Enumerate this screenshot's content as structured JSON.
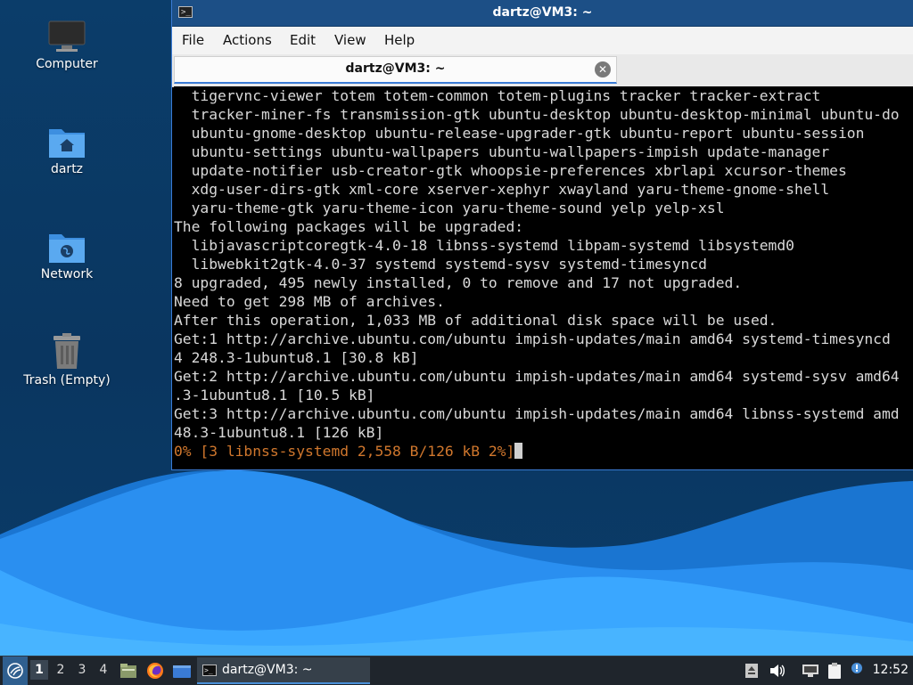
{
  "desktop": {
    "icons": [
      {
        "label": "Computer"
      },
      {
        "label": "dartz"
      },
      {
        "label": "Network"
      },
      {
        "label": "Trash (Empty)"
      }
    ]
  },
  "window": {
    "title": "dartz@VM3: ~",
    "menu": [
      "File",
      "Actions",
      "Edit",
      "View",
      "Help"
    ],
    "tab_title": "dartz@VM3: ~",
    "terminal_lines": [
      "  tigervnc-viewer totem totem-common totem-plugins tracker tracker-extract",
      "  tracker-miner-fs transmission-gtk ubuntu-desktop ubuntu-desktop-minimal ubuntu-do",
      "  ubuntu-gnome-desktop ubuntu-release-upgrader-gtk ubuntu-report ubuntu-session",
      "  ubuntu-settings ubuntu-wallpapers ubuntu-wallpapers-impish update-manager",
      "  update-notifier usb-creator-gtk whoopsie-preferences xbrlapi xcursor-themes",
      "  xdg-user-dirs-gtk xml-core xserver-xephyr xwayland yaru-theme-gnome-shell",
      "  yaru-theme-gtk yaru-theme-icon yaru-theme-sound yelp yelp-xsl",
      "The following packages will be upgraded:",
      "  libjavascriptcoregtk-4.0-18 libnss-systemd libpam-systemd libsystemd0",
      "  libwebkit2gtk-4.0-37 systemd systemd-sysv systemd-timesyncd",
      "8 upgraded, 495 newly installed, 0 to remove and 17 not upgraded.",
      "Need to get 298 MB of archives.",
      "After this operation, 1,033 MB of additional disk space will be used.",
      "Get:1 http://archive.ubuntu.com/ubuntu impish-updates/main amd64 systemd-timesyncd",
      "4 248.3-1ubuntu8.1 [30.8 kB]",
      "Get:2 http://archive.ubuntu.com/ubuntu impish-updates/main amd64 systemd-sysv amd64",
      ".3-1ubuntu8.1 [10.5 kB]",
      "Get:3 http://archive.ubuntu.com/ubuntu impish-updates/main amd64 libnss-systemd amd",
      "48.3-1ubuntu8.1 [126 kB]"
    ],
    "progress_line": "0% [3 libnss-systemd 2,558 B/126 kB 2%]"
  },
  "taskbar": {
    "workspaces": [
      "1",
      "2",
      "3",
      "4"
    ],
    "task_label": "dartz@VM3: ~",
    "clock": "12:52"
  },
  "colors": {
    "desktop_bg": "#0b3d6a",
    "wave_light": "#39a6ff",
    "wave_mid": "#1583e8",
    "progress_text": "#d0772d",
    "title_bar": "#1c4f86"
  },
  "icons": {
    "start": "lubuntu-logo-icon",
    "computer": "monitor-icon",
    "home": "home-folder-icon",
    "network": "network-folder-icon",
    "trash": "trash-icon"
  }
}
